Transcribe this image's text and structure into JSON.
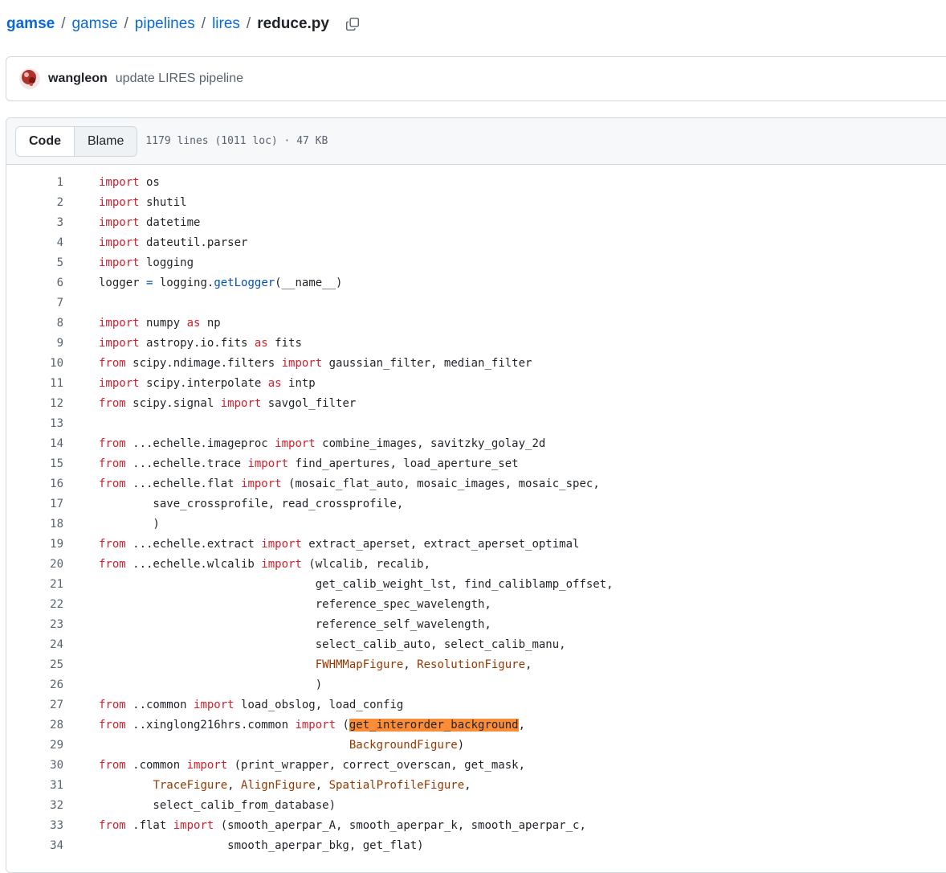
{
  "breadcrumb": {
    "items": [
      "gamse",
      "gamse",
      "pipelines",
      "lires"
    ],
    "separator": "/",
    "current": "reduce.py"
  },
  "commit": {
    "author": "wangleon",
    "message": "update LIRES pipeline"
  },
  "file_header": {
    "tab_code": "Code",
    "tab_blame": "Blame",
    "meta": "1179 lines (1011 loc) · 47 KB"
  },
  "colors": {
    "link": "#0969da",
    "keyword": "#cf222e",
    "function": "#0550ae",
    "class": "#953800",
    "highlight": "#fd8c37"
  },
  "code": {
    "lines": [
      [
        {
          "t": "import",
          "c": "kw"
        },
        {
          "t": " os"
        }
      ],
      [
        {
          "t": "import",
          "c": "kw"
        },
        {
          "t": " shutil"
        }
      ],
      [
        {
          "t": "import",
          "c": "kw"
        },
        {
          "t": " datetime"
        }
      ],
      [
        {
          "t": "import",
          "c": "kw"
        },
        {
          "t": " dateutil.parser"
        }
      ],
      [
        {
          "t": "import",
          "c": "kw"
        },
        {
          "t": " logging"
        }
      ],
      [
        {
          "t": "logger "
        },
        {
          "t": "=",
          "c": "fn"
        },
        {
          "t": " logging."
        },
        {
          "t": "getLogger",
          "c": "fn"
        },
        {
          "t": "(__name__)"
        }
      ],
      [],
      [
        {
          "t": "import",
          "c": "kw"
        },
        {
          "t": " numpy "
        },
        {
          "t": "as",
          "c": "kw"
        },
        {
          "t": " np"
        }
      ],
      [
        {
          "t": "import",
          "c": "kw"
        },
        {
          "t": " astropy.io.fits "
        },
        {
          "t": "as",
          "c": "kw"
        },
        {
          "t": " fits"
        }
      ],
      [
        {
          "t": "from",
          "c": "kw"
        },
        {
          "t": " scipy.ndimage.filters "
        },
        {
          "t": "import",
          "c": "kw"
        },
        {
          "t": " gaussian_filter, median_filter"
        }
      ],
      [
        {
          "t": "import",
          "c": "kw"
        },
        {
          "t": " scipy.interpolate "
        },
        {
          "t": "as",
          "c": "kw"
        },
        {
          "t": " intp"
        }
      ],
      [
        {
          "t": "from",
          "c": "kw"
        },
        {
          "t": " scipy.signal "
        },
        {
          "t": "import",
          "c": "kw"
        },
        {
          "t": " savgol_filter"
        }
      ],
      [],
      [
        {
          "t": "from",
          "c": "kw"
        },
        {
          "t": " ...echelle.imageproc "
        },
        {
          "t": "import",
          "c": "kw"
        },
        {
          "t": " combine_images, savitzky_golay_2d"
        }
      ],
      [
        {
          "t": "from",
          "c": "kw"
        },
        {
          "t": " ...echelle.trace "
        },
        {
          "t": "import",
          "c": "kw"
        },
        {
          "t": " find_apertures, load_aperture_set"
        }
      ],
      [
        {
          "t": "from",
          "c": "kw"
        },
        {
          "t": " ...echelle.flat "
        },
        {
          "t": "import",
          "c": "kw"
        },
        {
          "t": " (mosaic_flat_auto, mosaic_images, mosaic_spec,"
        }
      ],
      [
        {
          "t": "        save_crossprofile, read_crossprofile,"
        }
      ],
      [
        {
          "t": "        )"
        }
      ],
      [
        {
          "t": "from",
          "c": "kw"
        },
        {
          "t": " ...echelle.extract "
        },
        {
          "t": "import",
          "c": "kw"
        },
        {
          "t": " extract_aperset, extract_aperset_optimal"
        }
      ],
      [
        {
          "t": "from",
          "c": "kw"
        },
        {
          "t": " ...echelle.wlcalib "
        },
        {
          "t": "import",
          "c": "kw"
        },
        {
          "t": " (wlcalib, recalib,"
        }
      ],
      [
        {
          "t": "                                get_calib_weight_lst, find_caliblamp_offset,"
        }
      ],
      [
        {
          "t": "                                reference_spec_wavelength,"
        }
      ],
      [
        {
          "t": "                                reference_self_wavelength,"
        }
      ],
      [
        {
          "t": "                                select_calib_auto, select_calib_manu,"
        }
      ],
      [
        {
          "t": "                                "
        },
        {
          "t": "FWHMMapFigure",
          "c": "cls"
        },
        {
          "t": ", "
        },
        {
          "t": "ResolutionFigure",
          "c": "cls"
        },
        {
          "t": ","
        }
      ],
      [
        {
          "t": "                                )"
        }
      ],
      [
        {
          "t": "from",
          "c": "kw"
        },
        {
          "t": " ..common "
        },
        {
          "t": "import",
          "c": "kw"
        },
        {
          "t": " load_obslog, load_config"
        }
      ],
      [
        {
          "t": "from",
          "c": "kw"
        },
        {
          "t": " ..xinglong216hrs.common "
        },
        {
          "t": "import",
          "c": "kw"
        },
        {
          "t": " ("
        },
        {
          "t": "get_interorder_background",
          "c": "hl"
        },
        {
          "t": ","
        }
      ],
      [
        {
          "t": "                                     "
        },
        {
          "t": "BackgroundFigure",
          "c": "cls"
        },
        {
          "t": ")"
        }
      ],
      [
        {
          "t": "from",
          "c": "kw"
        },
        {
          "t": " .common "
        },
        {
          "t": "import",
          "c": "kw"
        },
        {
          "t": " (print_wrapper, correct_overscan, get_mask,"
        }
      ],
      [
        {
          "t": "        "
        },
        {
          "t": "TraceFigure",
          "c": "cls"
        },
        {
          "t": ", "
        },
        {
          "t": "AlignFigure",
          "c": "cls"
        },
        {
          "t": ", "
        },
        {
          "t": "SpatialProfileFigure",
          "c": "cls"
        },
        {
          "t": ","
        }
      ],
      [
        {
          "t": "        select_calib_from_database)"
        }
      ],
      [
        {
          "t": "from",
          "c": "kw"
        },
        {
          "t": " .flat "
        },
        {
          "t": "import",
          "c": "kw"
        },
        {
          "t": " (smooth_aperpar_A, smooth_aperpar_k, smooth_aperpar_c,"
        }
      ],
      [
        {
          "t": "                   smooth_aperpar_bkg, get_flat)"
        }
      ]
    ]
  }
}
